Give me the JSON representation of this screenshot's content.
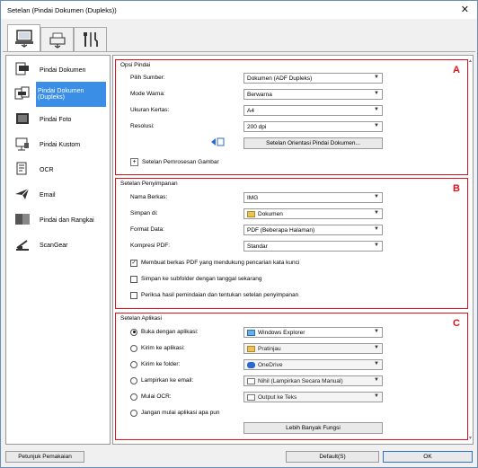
{
  "window": {
    "title": "Setelan (Pindai Dokumen (Dupleks))",
    "close_glyph": "✕"
  },
  "tabs": [
    {
      "icon": "scan-from-computer-icon"
    },
    {
      "icon": "scan-from-panel-icon"
    },
    {
      "icon": "general-settings-tools-icon"
    }
  ],
  "sidebar": {
    "items": [
      {
        "label": "Pindai Dokumen",
        "icon": "document-scan-icon"
      },
      {
        "label": "Pindai Dokumen (Dupleks)",
        "icon": "duplex-document-scan-icon"
      },
      {
        "label": "Pindai Foto",
        "icon": "photo-scan-icon"
      },
      {
        "label": "Pindai Kustom",
        "icon": "custom-scan-icon"
      },
      {
        "label": "OCR",
        "icon": "ocr-icon"
      },
      {
        "label": "Email",
        "icon": "email-icon"
      },
      {
        "label": "Pindai dan Rangkai",
        "icon": "scan-and-stitch-icon"
      },
      {
        "label": "ScanGear",
        "icon": "scangear-icon"
      }
    ]
  },
  "scan_options": {
    "title": "Opsi Pindai",
    "letter": "A",
    "source_label": "Pilih Sumber:",
    "source_value": "Dokumen (ADF Dupleks)",
    "color_label": "Mode Warna:",
    "color_value": "Berwarna",
    "paper_label": "Ukuran Kertas:",
    "paper_value": "A4",
    "resolution_label": "Resolusi:",
    "resolution_value": "200 dpi",
    "orientation_button": "Setelan Orientasi Pindai Dokumen...",
    "image_processing": "Setelan Pemrosesan Gambar",
    "expand_glyph": "+"
  },
  "save_settings": {
    "title": "Setelan Penyimpanan",
    "letter": "B",
    "filename_label": "Nama Berkas:",
    "filename_value": "IMG",
    "savein_label": "Simpan di:",
    "savein_value": "Dokumen",
    "format_label": "Format Data:",
    "format_value": "PDF (Beberapa Halaman)",
    "compression_label": "Kompresi PDF:",
    "compression_value": "Standar",
    "check_keyword": "Membuat berkas PDF yang mendukung pencarian kata kunci",
    "check_subfolder": "Simpan ke subfolder dengan tanggal sekarang",
    "check_review": "Periksa hasil pemindaian dan tentukan setelan penyimpanan",
    "checkmark": "✓"
  },
  "app_settings": {
    "title": "Setelan Aplikasi",
    "letter": "C",
    "open_with_label": "Buka dengan aplikasi:",
    "open_with_value": "Windows Explorer",
    "send_app_label": "Kirim ke aplikasi:",
    "send_app_value": "Pratinjau",
    "send_folder_label": "Kirim ke folder:",
    "send_folder_value": "OneDrive",
    "attach_email_label": "Lampirkan ke email:",
    "attach_email_value": "Nihil (Lampirkan Secara Manual)",
    "start_ocr_label": "Mulai OCR:",
    "start_ocr_value": "Output ke Teks",
    "no_app_label": "Jangan mulai aplikasi apa pun",
    "more_button": "Lebih Banyak Fungsi"
  },
  "footer": {
    "guide_button": "Petunjuk Pemakaian",
    "defaults_button": "Default(S)",
    "ok_button": "OK"
  },
  "glyphs": {
    "dropdown": "▼",
    "scroll_up": "▲",
    "scroll_down": "▼"
  },
  "colors": {
    "selection": "#3a8ee6",
    "annotation": "#e0101a"
  }
}
